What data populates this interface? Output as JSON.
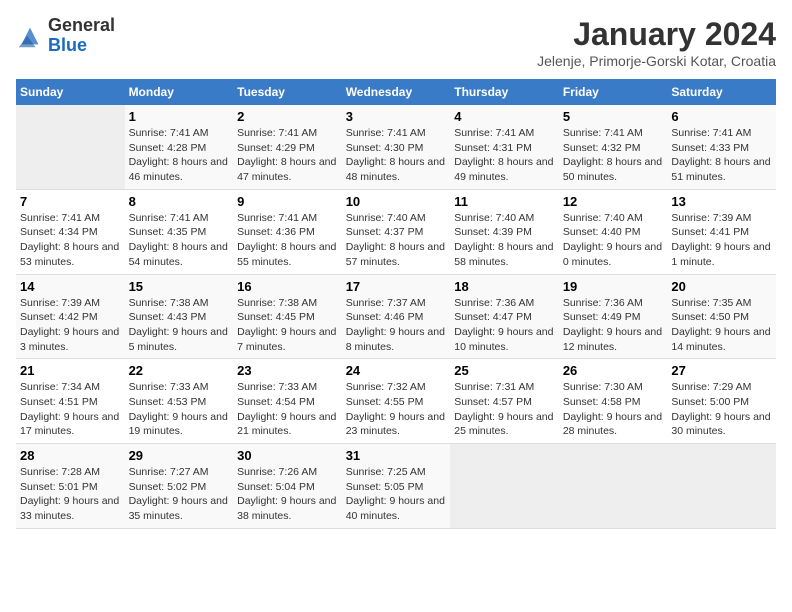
{
  "header": {
    "logo_general": "General",
    "logo_blue": "Blue",
    "month_title": "January 2024",
    "location": "Jelenje, Primorje-Gorski Kotar, Croatia"
  },
  "days_of_week": [
    "Sunday",
    "Monday",
    "Tuesday",
    "Wednesday",
    "Thursday",
    "Friday",
    "Saturday"
  ],
  "weeks": [
    [
      {
        "day": "",
        "sunrise": "",
        "sunset": "",
        "daylight": ""
      },
      {
        "day": "1",
        "sunrise": "Sunrise: 7:41 AM",
        "sunset": "Sunset: 4:28 PM",
        "daylight": "Daylight: 8 hours and 46 minutes."
      },
      {
        "day": "2",
        "sunrise": "Sunrise: 7:41 AM",
        "sunset": "Sunset: 4:29 PM",
        "daylight": "Daylight: 8 hours and 47 minutes."
      },
      {
        "day": "3",
        "sunrise": "Sunrise: 7:41 AM",
        "sunset": "Sunset: 4:30 PM",
        "daylight": "Daylight: 8 hours and 48 minutes."
      },
      {
        "day": "4",
        "sunrise": "Sunrise: 7:41 AM",
        "sunset": "Sunset: 4:31 PM",
        "daylight": "Daylight: 8 hours and 49 minutes."
      },
      {
        "day": "5",
        "sunrise": "Sunrise: 7:41 AM",
        "sunset": "Sunset: 4:32 PM",
        "daylight": "Daylight: 8 hours and 50 minutes."
      },
      {
        "day": "6",
        "sunrise": "Sunrise: 7:41 AM",
        "sunset": "Sunset: 4:33 PM",
        "daylight": "Daylight: 8 hours and 51 minutes."
      }
    ],
    [
      {
        "day": "7",
        "sunrise": "Sunrise: 7:41 AM",
        "sunset": "Sunset: 4:34 PM",
        "daylight": "Daylight: 8 hours and 53 minutes."
      },
      {
        "day": "8",
        "sunrise": "Sunrise: 7:41 AM",
        "sunset": "Sunset: 4:35 PM",
        "daylight": "Daylight: 8 hours and 54 minutes."
      },
      {
        "day": "9",
        "sunrise": "Sunrise: 7:41 AM",
        "sunset": "Sunset: 4:36 PM",
        "daylight": "Daylight: 8 hours and 55 minutes."
      },
      {
        "day": "10",
        "sunrise": "Sunrise: 7:40 AM",
        "sunset": "Sunset: 4:37 PM",
        "daylight": "Daylight: 8 hours and 57 minutes."
      },
      {
        "day": "11",
        "sunrise": "Sunrise: 7:40 AM",
        "sunset": "Sunset: 4:39 PM",
        "daylight": "Daylight: 8 hours and 58 minutes."
      },
      {
        "day": "12",
        "sunrise": "Sunrise: 7:40 AM",
        "sunset": "Sunset: 4:40 PM",
        "daylight": "Daylight: 9 hours and 0 minutes."
      },
      {
        "day": "13",
        "sunrise": "Sunrise: 7:39 AM",
        "sunset": "Sunset: 4:41 PM",
        "daylight": "Daylight: 9 hours and 1 minute."
      }
    ],
    [
      {
        "day": "14",
        "sunrise": "Sunrise: 7:39 AM",
        "sunset": "Sunset: 4:42 PM",
        "daylight": "Daylight: 9 hours and 3 minutes."
      },
      {
        "day": "15",
        "sunrise": "Sunrise: 7:38 AM",
        "sunset": "Sunset: 4:43 PM",
        "daylight": "Daylight: 9 hours and 5 minutes."
      },
      {
        "day": "16",
        "sunrise": "Sunrise: 7:38 AM",
        "sunset": "Sunset: 4:45 PM",
        "daylight": "Daylight: 9 hours and 7 minutes."
      },
      {
        "day": "17",
        "sunrise": "Sunrise: 7:37 AM",
        "sunset": "Sunset: 4:46 PM",
        "daylight": "Daylight: 9 hours and 8 minutes."
      },
      {
        "day": "18",
        "sunrise": "Sunrise: 7:36 AM",
        "sunset": "Sunset: 4:47 PM",
        "daylight": "Daylight: 9 hours and 10 minutes."
      },
      {
        "day": "19",
        "sunrise": "Sunrise: 7:36 AM",
        "sunset": "Sunset: 4:49 PM",
        "daylight": "Daylight: 9 hours and 12 minutes."
      },
      {
        "day": "20",
        "sunrise": "Sunrise: 7:35 AM",
        "sunset": "Sunset: 4:50 PM",
        "daylight": "Daylight: 9 hours and 14 minutes."
      }
    ],
    [
      {
        "day": "21",
        "sunrise": "Sunrise: 7:34 AM",
        "sunset": "Sunset: 4:51 PM",
        "daylight": "Daylight: 9 hours and 17 minutes."
      },
      {
        "day": "22",
        "sunrise": "Sunrise: 7:33 AM",
        "sunset": "Sunset: 4:53 PM",
        "daylight": "Daylight: 9 hours and 19 minutes."
      },
      {
        "day": "23",
        "sunrise": "Sunrise: 7:33 AM",
        "sunset": "Sunset: 4:54 PM",
        "daylight": "Daylight: 9 hours and 21 minutes."
      },
      {
        "day": "24",
        "sunrise": "Sunrise: 7:32 AM",
        "sunset": "Sunset: 4:55 PM",
        "daylight": "Daylight: 9 hours and 23 minutes."
      },
      {
        "day": "25",
        "sunrise": "Sunrise: 7:31 AM",
        "sunset": "Sunset: 4:57 PM",
        "daylight": "Daylight: 9 hours and 25 minutes."
      },
      {
        "day": "26",
        "sunrise": "Sunrise: 7:30 AM",
        "sunset": "Sunset: 4:58 PM",
        "daylight": "Daylight: 9 hours and 28 minutes."
      },
      {
        "day": "27",
        "sunrise": "Sunrise: 7:29 AM",
        "sunset": "Sunset: 5:00 PM",
        "daylight": "Daylight: 9 hours and 30 minutes."
      }
    ],
    [
      {
        "day": "28",
        "sunrise": "Sunrise: 7:28 AM",
        "sunset": "Sunset: 5:01 PM",
        "daylight": "Daylight: 9 hours and 33 minutes."
      },
      {
        "day": "29",
        "sunrise": "Sunrise: 7:27 AM",
        "sunset": "Sunset: 5:02 PM",
        "daylight": "Daylight: 9 hours and 35 minutes."
      },
      {
        "day": "30",
        "sunrise": "Sunrise: 7:26 AM",
        "sunset": "Sunset: 5:04 PM",
        "daylight": "Daylight: 9 hours and 38 minutes."
      },
      {
        "day": "31",
        "sunrise": "Sunrise: 7:25 AM",
        "sunset": "Sunset: 5:05 PM",
        "daylight": "Daylight: 9 hours and 40 minutes."
      },
      {
        "day": "",
        "sunrise": "",
        "sunset": "",
        "daylight": ""
      },
      {
        "day": "",
        "sunrise": "",
        "sunset": "",
        "daylight": ""
      },
      {
        "day": "",
        "sunrise": "",
        "sunset": "",
        "daylight": ""
      }
    ]
  ]
}
